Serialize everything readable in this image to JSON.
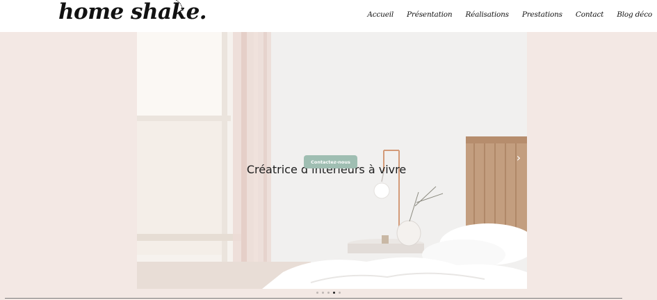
{
  "header": {
    "logo_text": "home shake.",
    "nav": [
      "Accueil",
      "Présentation",
      "Réalisations",
      "Prestations",
      "Contact",
      "Blog déco"
    ]
  },
  "slider": {
    "title": "Créatrice d’intérieurs à vivre",
    "cta_label": "Contactez-nous",
    "next_icon": "chevron-right-icon",
    "next_glyph": "›",
    "active_dot": 4,
    "dot_count": 5
  }
}
